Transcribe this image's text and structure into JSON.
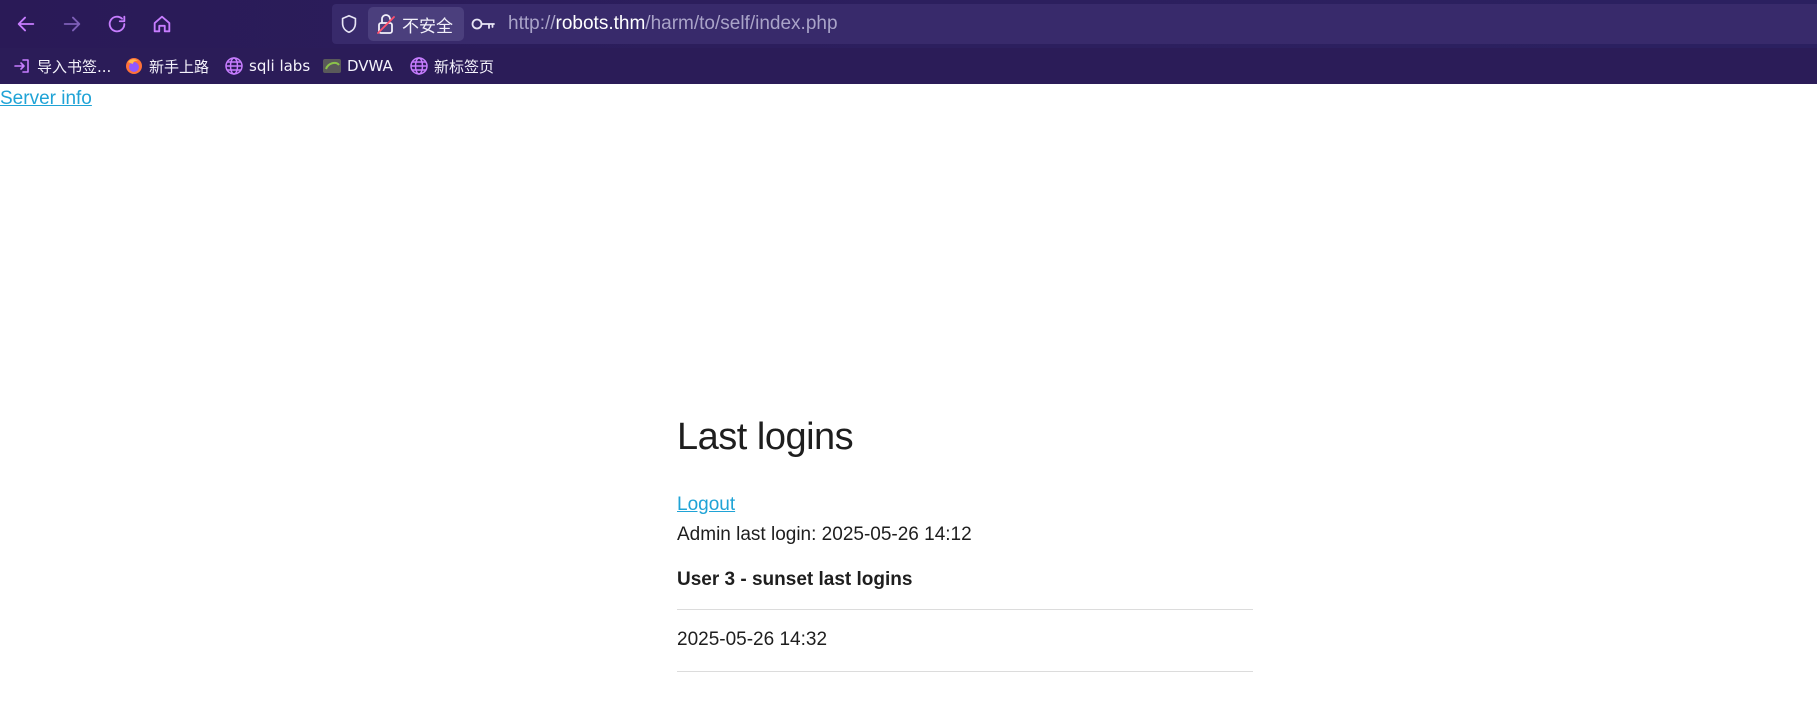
{
  "browser": {
    "security_label": "不安全",
    "url_prefix": "http://",
    "url_host": "robots.thm",
    "url_path": "/harm/to/self/index.php",
    "nav_icons": [
      "back-icon",
      "forward-icon",
      "reload-icon",
      "home-icon"
    ],
    "accent_color": "#c77dff"
  },
  "bookmarks": [
    {
      "label": "导入书签...",
      "icon": "import-icon"
    },
    {
      "label": "新手上路",
      "icon": "firefox-icon"
    },
    {
      "label": "sqli labs",
      "icon": "globe-icon"
    },
    {
      "label": "DVWA",
      "icon": "dvwa-icon"
    },
    {
      "label": "新标签页",
      "icon": "globe-icon"
    }
  ],
  "page": {
    "server_info_link": "Server info",
    "title": "Last logins",
    "logout_link": "Logout",
    "admin_last_login": "Admin last login: 2025-05-26 14:12",
    "user_heading": "User 3 - sunset last logins",
    "logins": [
      "2025-05-26 14:32"
    ],
    "link_color": "#1fa3d6"
  }
}
